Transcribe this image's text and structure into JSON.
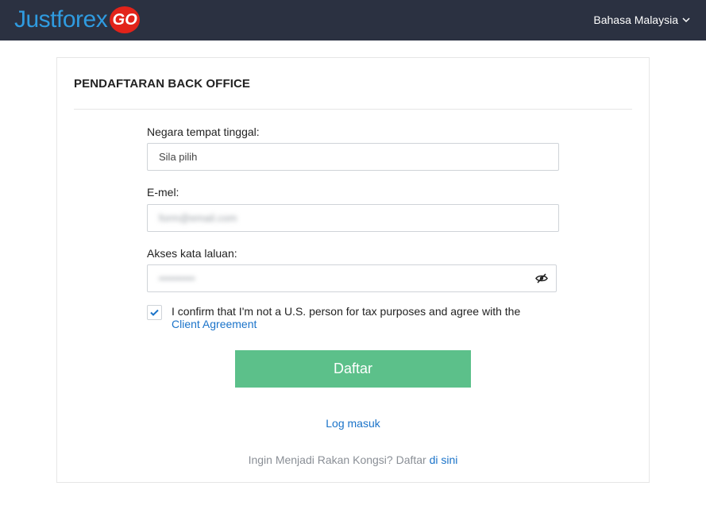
{
  "header": {
    "logo_text": "Justforex",
    "logo_badge": "GO",
    "language": "Bahasa Malaysia"
  },
  "form": {
    "title": "PENDAFTARAN BACK OFFICE",
    "country": {
      "label": "Negara tempat tinggal:",
      "value": "Sila pilih"
    },
    "email": {
      "label": "E-mel:",
      "value": "form@email.com"
    },
    "password": {
      "label": "Akses kata laluan:",
      "value": "••••••••••"
    },
    "confirm_text": "I confirm that I'm not a U.S. person for tax purposes and agree with the",
    "confirm_link": "Client Agreement",
    "checkbox_checked": true,
    "submit_label": "Daftar",
    "login_link": "Log masuk",
    "partner_text": "Ingin Menjadi Rakan Kongsi? Daftar",
    "partner_link": "di sini"
  },
  "colors": {
    "topbar": "#2b3141",
    "logo_blue": "#2f9be0",
    "logo_red": "#e2231a",
    "accent_green": "#5cc08a",
    "link_blue": "#1a73c9"
  },
  "icons": {
    "language": "chevron-down-icon",
    "password": "eye-slash-icon",
    "checkbox": "checkmark-icon"
  }
}
